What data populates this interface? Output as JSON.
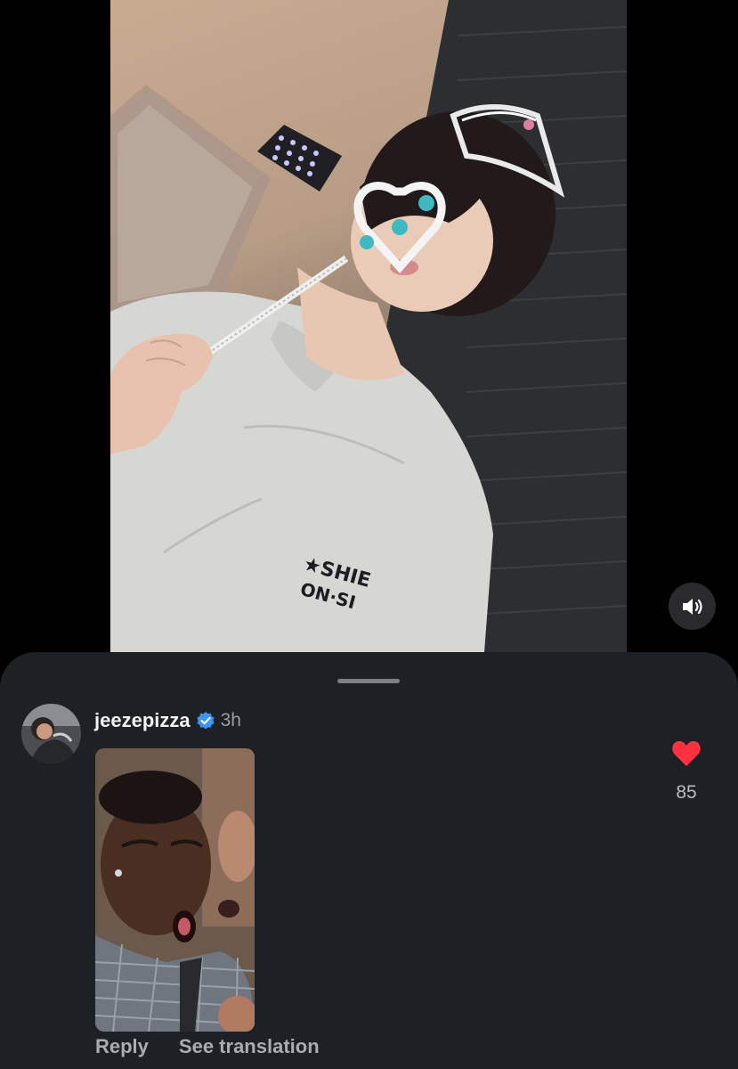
{
  "video": {
    "mute_icon": "speaker-icon"
  },
  "comment": {
    "username": "jeezepizza",
    "verified_icon": "verified-badge-icon",
    "time": "3h",
    "like_icon": "heart-icon",
    "like_color": "#ff3040",
    "likes": "85",
    "reply_label": "Reply",
    "translate_label": "See translation"
  }
}
